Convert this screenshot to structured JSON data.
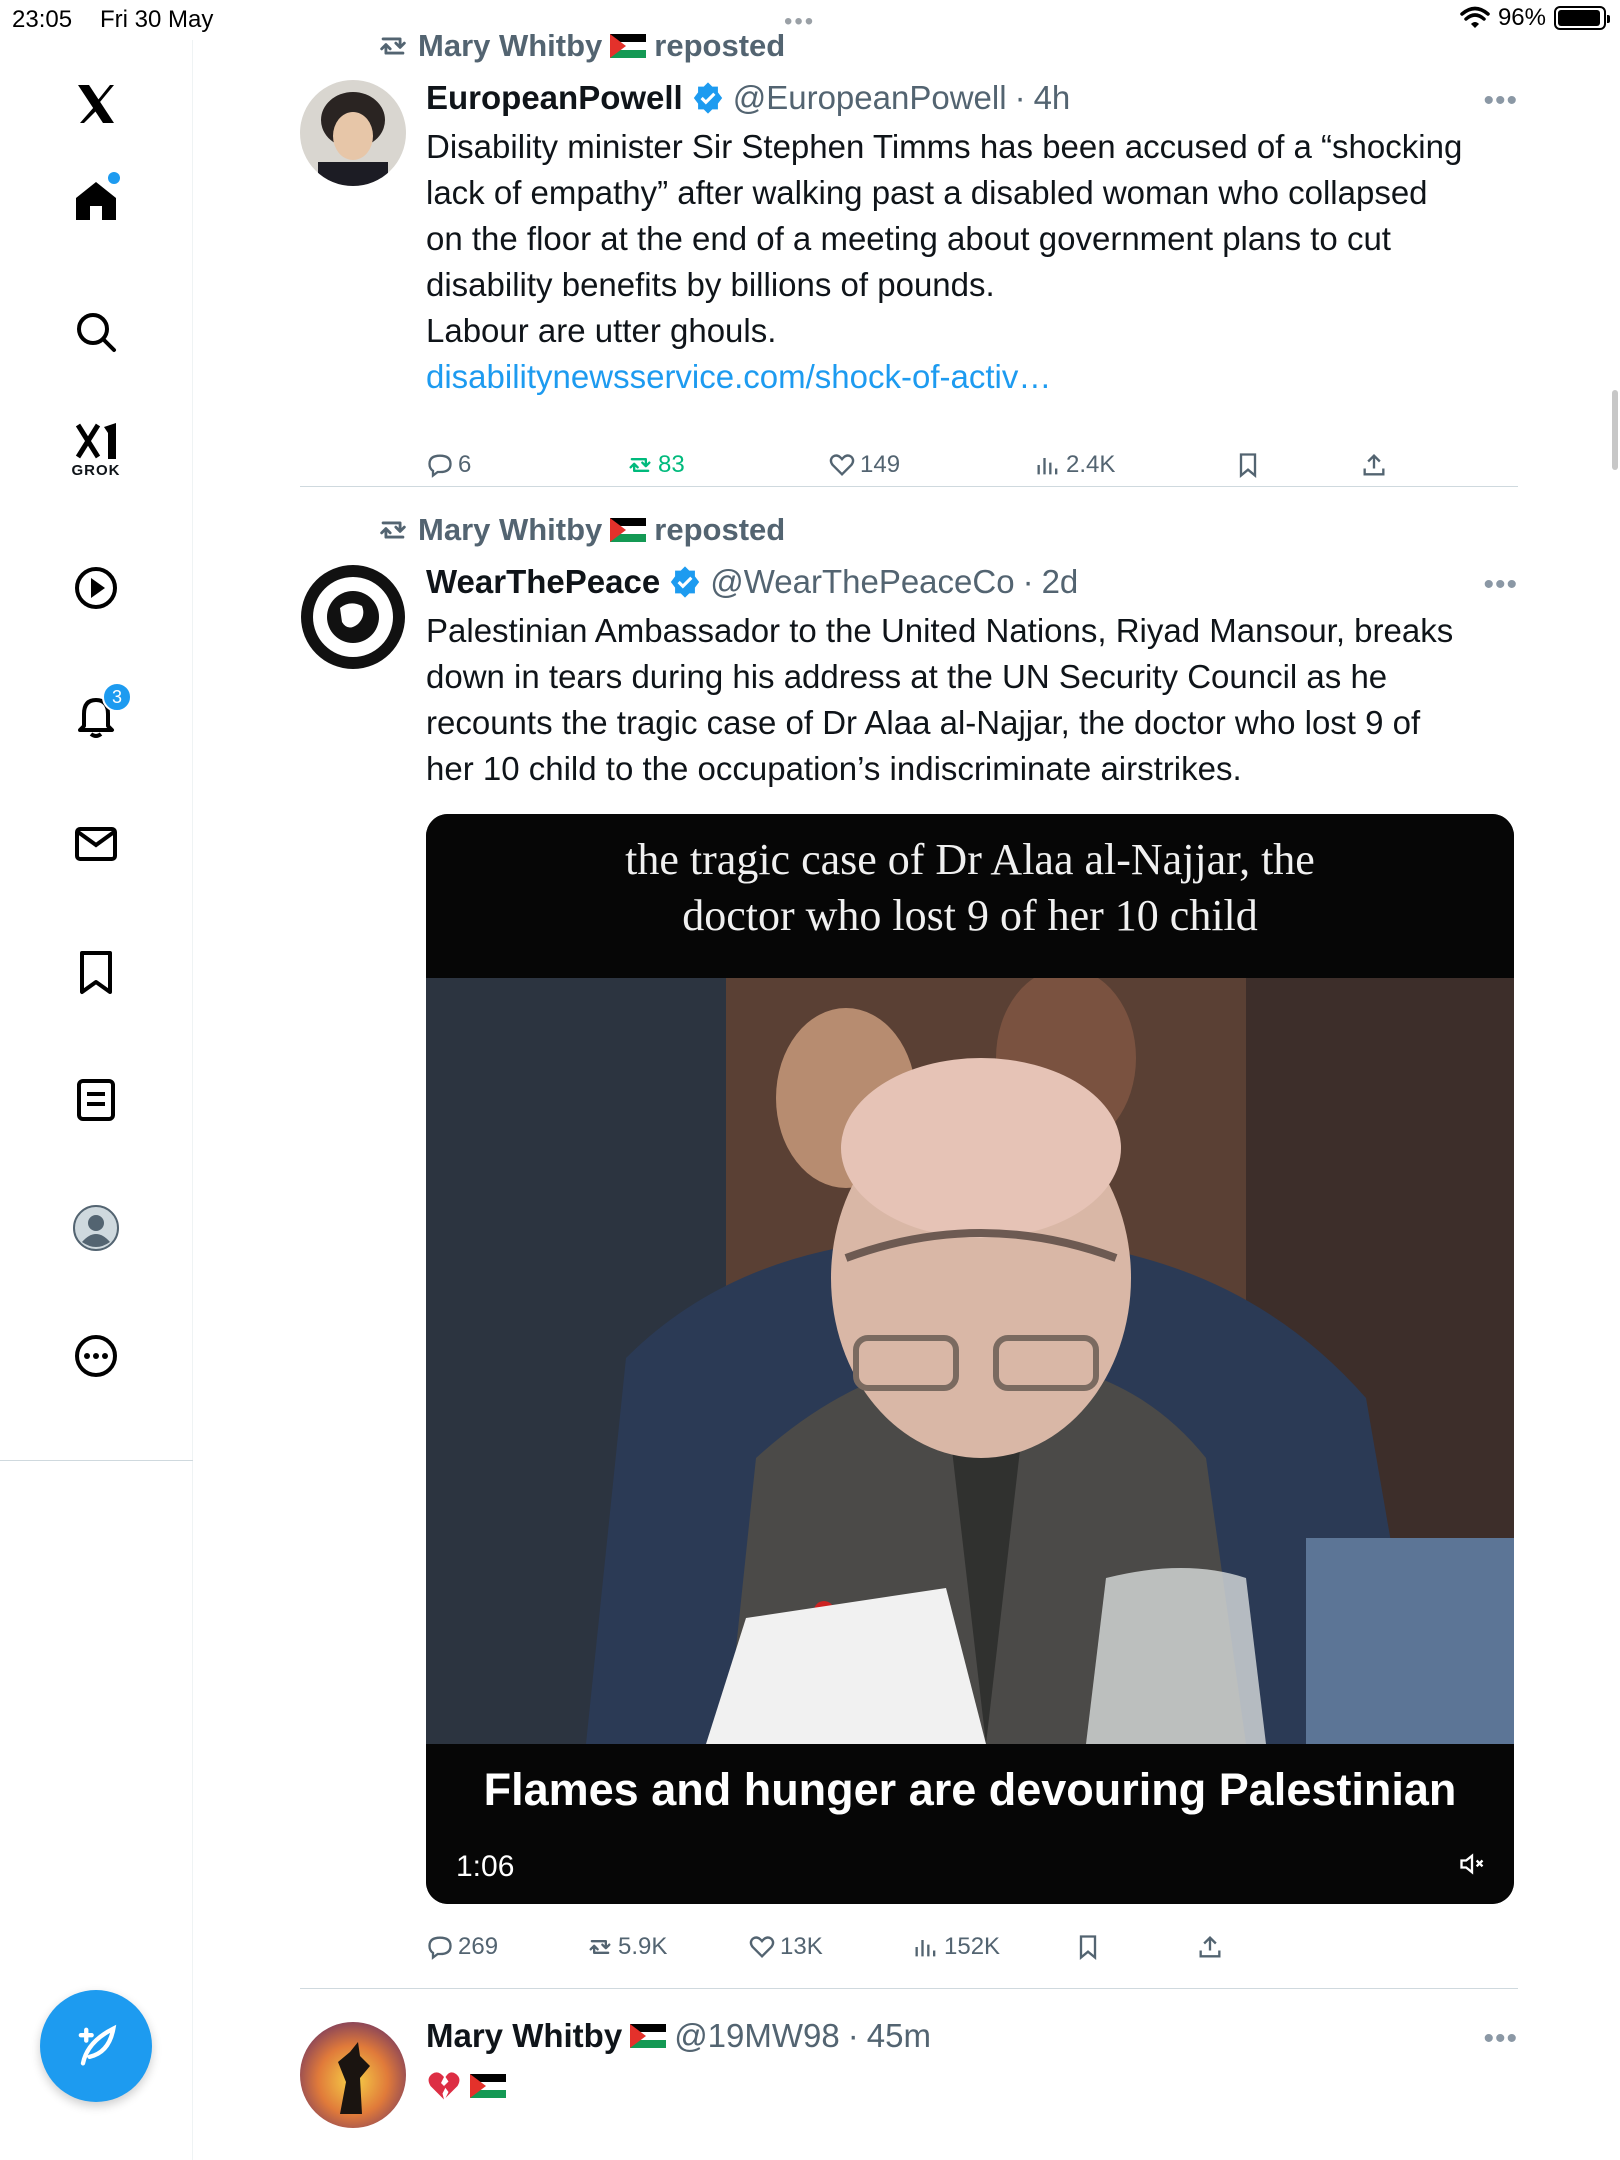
{
  "status_bar": {
    "time": "23:05",
    "date": "Fri 30 May",
    "battery": "96%",
    "battery_level": 0.96
  },
  "sidebar": {
    "items": [
      {
        "name": "x-logo",
        "icon": "x-logo-icon"
      },
      {
        "name": "home",
        "icon": "home-icon",
        "has_dot": true
      },
      {
        "name": "search",
        "icon": "search-icon"
      },
      {
        "name": "grok",
        "icon": "grok-icon",
        "label": "GROK"
      },
      {
        "name": "videos",
        "icon": "play-icon"
      },
      {
        "name": "notifications",
        "icon": "bell-icon",
        "badge": "3"
      },
      {
        "name": "messages",
        "icon": "mail-icon"
      },
      {
        "name": "bookmarks",
        "icon": "bookmark-icon"
      },
      {
        "name": "lists",
        "icon": "list-icon"
      },
      {
        "name": "profile",
        "icon": "profile-icon"
      },
      {
        "name": "more",
        "icon": "more-circle-icon"
      }
    ],
    "compose_icon": "compose-feather-icon"
  },
  "colors": {
    "accent": "#1d9bf0",
    "text": "#0f1419",
    "muted": "#536471",
    "repost_green": "#00ba7c"
  },
  "posts": [
    {
      "repost_by": "Mary Whitby",
      "repost_suffix": "reposted",
      "name": "EuropeanPowell",
      "handle": "@EuropeanPowell",
      "time": "4h",
      "verified": true,
      "text_lines": [
        "Disability minister Sir Stephen Timms has been accused of a “shocking",
        "lack of empathy” after walking past a disabled woman who collapsed",
        "on the floor at the end of a meeting about government plans to cut",
        "disability benefits by billions of pounds.",
        "Labour are utter ghouls."
      ],
      "link": "disabilitynewsservice.com/shock-of-activ…",
      "replies": "6",
      "reposts": "83",
      "likes": "149",
      "views": "2.4K"
    },
    {
      "repost_by": "Mary Whitby",
      "repost_suffix": "reposted",
      "name": "WearThePeace",
      "handle": "@WearThePeaceCo",
      "time": "2d",
      "verified": true,
      "text_lines": [
        "Palestinian Ambassador to the United Nations, Riyad Mansour, breaks",
        "down in tears during his address at the UN Security Council as he",
        "recounts the tragic case of Dr Alaa al-Najjar, the doctor who lost 9 of",
        "her 10 child to the occupation’s indiscriminate airstrikes."
      ],
      "video": {
        "caption_top_line1": "the tragic case of Dr Alaa al-Najjar, the",
        "caption_top_line2": "doctor who lost 9 of her 10 child",
        "caption_bottom": "Flames and hunger are devouring Palestinian",
        "duration": "1:06"
      },
      "replies": "269",
      "reposts": "5.9K",
      "likes": "13K",
      "views": "152K"
    },
    {
      "name": "Mary Whitby",
      "handle": "@19MW98",
      "time": "45m",
      "verified": false
    }
  ]
}
